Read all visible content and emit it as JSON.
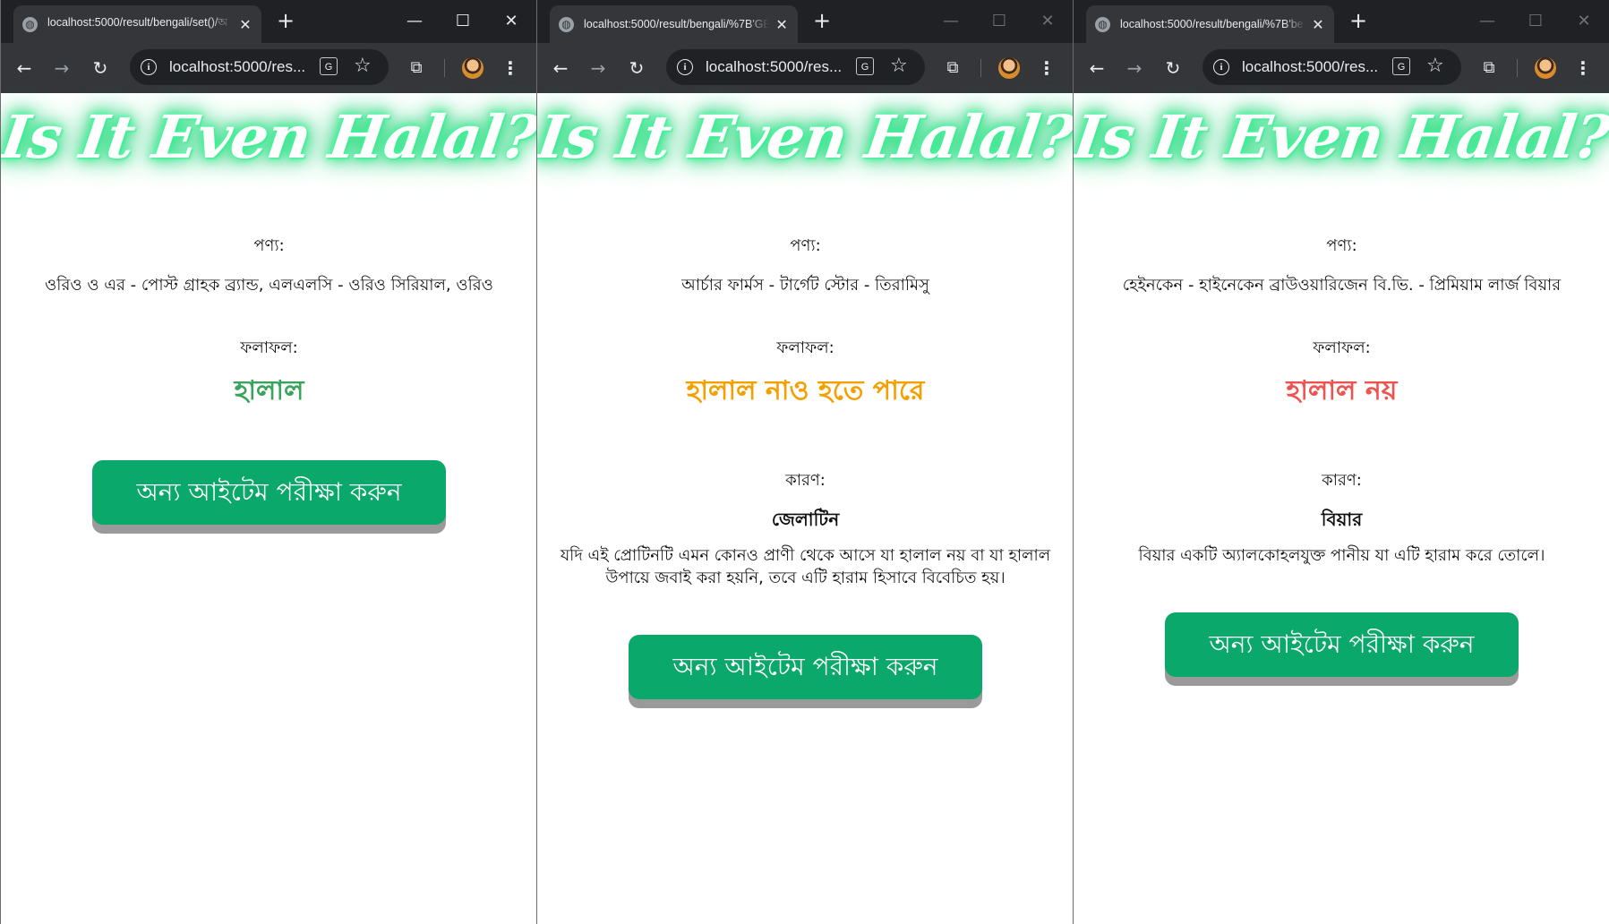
{
  "browser": {
    "new_tab_glyph": "+",
    "omnibox_url": "localhost:5000/res...",
    "translate_glyph": "G",
    "star_glyph": "☆",
    "menu_glyph": "⋮",
    "back_glyph": "←",
    "forward_glyph": "→",
    "reload_glyph": "↻",
    "tab_close_glyph": "✕",
    "minimize_glyph": "—",
    "maximize_glyph": "☐",
    "close_glyph": "✕",
    "tab_search_glyph": "⧉",
    "info_glyph": "i",
    "icons": [
      "globe-icon",
      "back-arrow-icon",
      "forward-arrow-icon",
      "reload-icon",
      "info-icon",
      "translate-icon",
      "star-icon",
      "tab-search-icon",
      "profile-avatar",
      "kebab-menu-icon",
      "minimize-icon",
      "maximize-icon",
      "close-icon"
    ]
  },
  "logo_text": "Is It Even Halal?",
  "labels": {
    "product": "পণ্য:",
    "result": "ফলাফল:",
    "reason": "কারণ:"
  },
  "button_label": "অন্য আইটেম পরীক্ষা করুন",
  "colors": {
    "halal": "#3aa35c",
    "maybe": "#f5a000",
    "not_halal": "#ef5350",
    "button": "#0aa86a",
    "logo_glow": "#22d67a"
  },
  "windows": [
    {
      "tab_title": "localhost:5000/result/bengali/set()/অ",
      "product": "ওরিও ও এর - পোস্ট গ্রাহক ব্র্যান্ড, এলএলসি - ওরিও সিরিয়াল, ওরিও",
      "verdict": "হালাল",
      "verdict_color": "#3aa35c"
    },
    {
      "tab_title": "localhost:5000/result/bengali/%7B'GE",
      "product": "আর্চার ফার্মস - টার্গেট স্টোর - তিরামিসু",
      "verdict": "হালাল নাও হতে পারে",
      "verdict_color": "#f5a000",
      "reason_title": "জেলাটিন",
      "reason_text": "যদি এই প্রোটিনটি এমন কোনও প্রাণী থেকে আসে যা হালাল নয় বা যা হালাল উপায়ে জবাই করা হয়নি, তবে এটি হারাম হিসাবে বিবেচিত হয়।"
    },
    {
      "tab_title": "localhost:5000/result/bengali/%7B'be",
      "product": "হেইনকেন - হাইনেকেন ব্রাউওয়ারিজেন বি.ভি. - প্রিমিয়াম লার্জ বিয়ার",
      "verdict": "হালাল নয়",
      "verdict_color": "#ef5350",
      "reason_title": "বিয়ার",
      "reason_text": "বিয়ার একটি অ্যালকোহলযুক্ত পানীয় যা এটি হারাম করে তোলে।"
    }
  ]
}
